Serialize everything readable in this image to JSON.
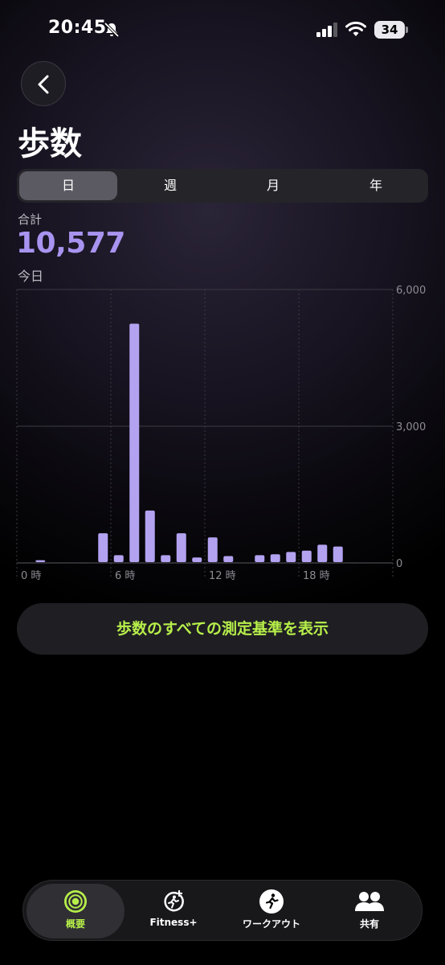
{
  "status": {
    "time": "20:45",
    "battery": "34"
  },
  "title": "歩数",
  "segments": [
    "日",
    "週",
    "月",
    "年"
  ],
  "selected_segment": "日",
  "summary": {
    "total_label": "合計",
    "total_value": "10,577",
    "period": "今日"
  },
  "colors": {
    "accent": "#a894f0",
    "bar": "#b3a2f0",
    "action": "#b7ef4a"
  },
  "chart_data": {
    "type": "bar",
    "categories": [
      "0",
      "1",
      "2",
      "3",
      "4",
      "5",
      "6",
      "7",
      "8",
      "9",
      "10",
      "11",
      "12",
      "13",
      "14",
      "15",
      "16",
      "17",
      "18",
      "19",
      "20",
      "21",
      "22",
      "23"
    ],
    "values": [
      0,
      60,
      0,
      0,
      0,
      650,
      170,
      5250,
      1150,
      170,
      650,
      120,
      560,
      150,
      0,
      170,
      190,
      240,
      270,
      400,
      360,
      0,
      0,
      0
    ],
    "x_ticks": [
      "0 時",
      "6 時",
      "12 時",
      "18 時"
    ],
    "y_ticks": [
      "0",
      "3,000",
      "6,000"
    ],
    "ylim": [
      0,
      6000
    ],
    "grid": true
  },
  "action_button": "歩数のすべての測定基準を表示",
  "tabs": [
    {
      "label": "概要",
      "icon": "activity-rings-icon"
    },
    {
      "label": "Fitness+",
      "icon": "fitness-plus-icon"
    },
    {
      "label": "ワークアウト",
      "icon": "workout-runner-icon"
    },
    {
      "label": "共有",
      "icon": "sharing-people-icon"
    }
  ]
}
